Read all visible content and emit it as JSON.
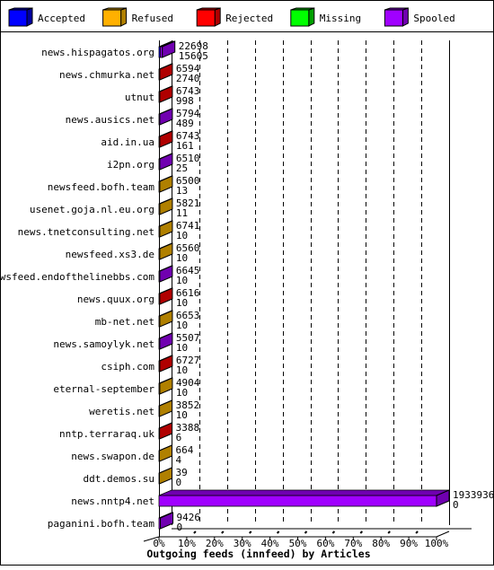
{
  "chart_data": {
    "type": "bar",
    "orientation": "horizontal",
    "stacked": true,
    "three_d": true,
    "title": "Outgoing feeds (innfeed) by Articles",
    "legend": {
      "placement": "top",
      "entries": [
        {
          "name": "Accepted",
          "color": "#0000ff",
          "side": "#0000a0"
        },
        {
          "name": "Refused",
          "color": "#ffb000",
          "side": "#b08000"
        },
        {
          "name": "Rejected",
          "color": "#ff0000",
          "side": "#b00000"
        },
        {
          "name": "Missing",
          "color": "#00ff00",
          "side": "#00a000"
        },
        {
          "name": "Spooled",
          "color": "#a000ff",
          "side": "#7000b0"
        }
      ]
    },
    "xlim": [
      0,
      100
    ],
    "x_ticks": [
      "0%",
      "10%",
      "20%",
      "30%",
      "40%",
      "50%",
      "60%",
      "70%",
      "80%",
      "90%",
      "100%"
    ],
    "grid": "vertical dashed",
    "rows": [
      {
        "host": "news.hispagatos.org",
        "v1": "22698",
        "v2": "15605",
        "pct": 1.2,
        "segments": [
          "Accepted",
          "Spooled"
        ]
      },
      {
        "host": "news.chmurka.net",
        "v1": "6594",
        "v2": "2740",
        "pct": 0.3,
        "segments": [
          "Rejected"
        ]
      },
      {
        "host": "utnut",
        "v1": "6743",
        "v2": "998",
        "pct": 0.3,
        "segments": [
          "Rejected"
        ]
      },
      {
        "host": "news.ausics.net",
        "v1": "5794",
        "v2": "489",
        "pct": 0.3,
        "segments": [
          "Spooled"
        ]
      },
      {
        "host": "aid.in.ua",
        "v1": "6743",
        "v2": "161",
        "pct": 0.3,
        "segments": [
          "Rejected"
        ]
      },
      {
        "host": "i2pn.org",
        "v1": "6510",
        "v2": "25",
        "pct": 0.3,
        "segments": [
          "Spooled"
        ]
      },
      {
        "host": "newsfeed.bofh.team",
        "v1": "6500",
        "v2": "13",
        "pct": 0.3,
        "segments": [
          "Refused"
        ]
      },
      {
        "host": "usenet.goja.nl.eu.org",
        "v1": "5821",
        "v2": "11",
        "pct": 0.3,
        "segments": [
          "Refused"
        ]
      },
      {
        "host": "news.tnetconsulting.net",
        "v1": "6741",
        "v2": "10",
        "pct": 0.3,
        "segments": [
          "Refused"
        ]
      },
      {
        "host": "newsfeed.xs3.de",
        "v1": "6560",
        "v2": "10",
        "pct": 0.3,
        "segments": [
          "Refused"
        ]
      },
      {
        "host": "newsfeed.endofthelinebbs.com",
        "v1": "6645",
        "v2": "10",
        "pct": 0.3,
        "segments": [
          "Spooled"
        ]
      },
      {
        "host": "news.quux.org",
        "v1": "6616",
        "v2": "10",
        "pct": 0.3,
        "segments": [
          "Rejected"
        ]
      },
      {
        "host": "mb-net.net",
        "v1": "6653",
        "v2": "10",
        "pct": 0.3,
        "segments": [
          "Refused"
        ]
      },
      {
        "host": "news.samoylyk.net",
        "v1": "5507",
        "v2": "10",
        "pct": 0.3,
        "segments": [
          "Spooled"
        ]
      },
      {
        "host": "csiph.com",
        "v1": "6727",
        "v2": "10",
        "pct": 0.3,
        "segments": [
          "Rejected"
        ]
      },
      {
        "host": "eternal-september",
        "v1": "4904",
        "v2": "10",
        "pct": 0.3,
        "segments": [
          "Refused"
        ]
      },
      {
        "host": "weretis.net",
        "v1": "3852",
        "v2": "10",
        "pct": 0.2,
        "segments": [
          "Refused"
        ]
      },
      {
        "host": "nntp.terraraq.uk",
        "v1": "3388",
        "v2": "6",
        "pct": 0.2,
        "segments": [
          "Rejected"
        ]
      },
      {
        "host": "news.swapon.de",
        "v1": "664",
        "v2": "4",
        "pct": 0.0,
        "segments": [
          "Refused"
        ]
      },
      {
        "host": "ddt.demos.su",
        "v1": "39",
        "v2": "0",
        "pct": 0.0,
        "segments": [
          "Refused"
        ]
      },
      {
        "host": "news.nntp4.net",
        "v1": "1933936",
        "v2": "0",
        "pct": 100,
        "segments": [
          "Spooled"
        ]
      },
      {
        "host": "paganini.bofh.team",
        "v1": "9426",
        "v2": "0",
        "pct": 0.5,
        "segments": [
          "Spooled"
        ]
      }
    ]
  }
}
